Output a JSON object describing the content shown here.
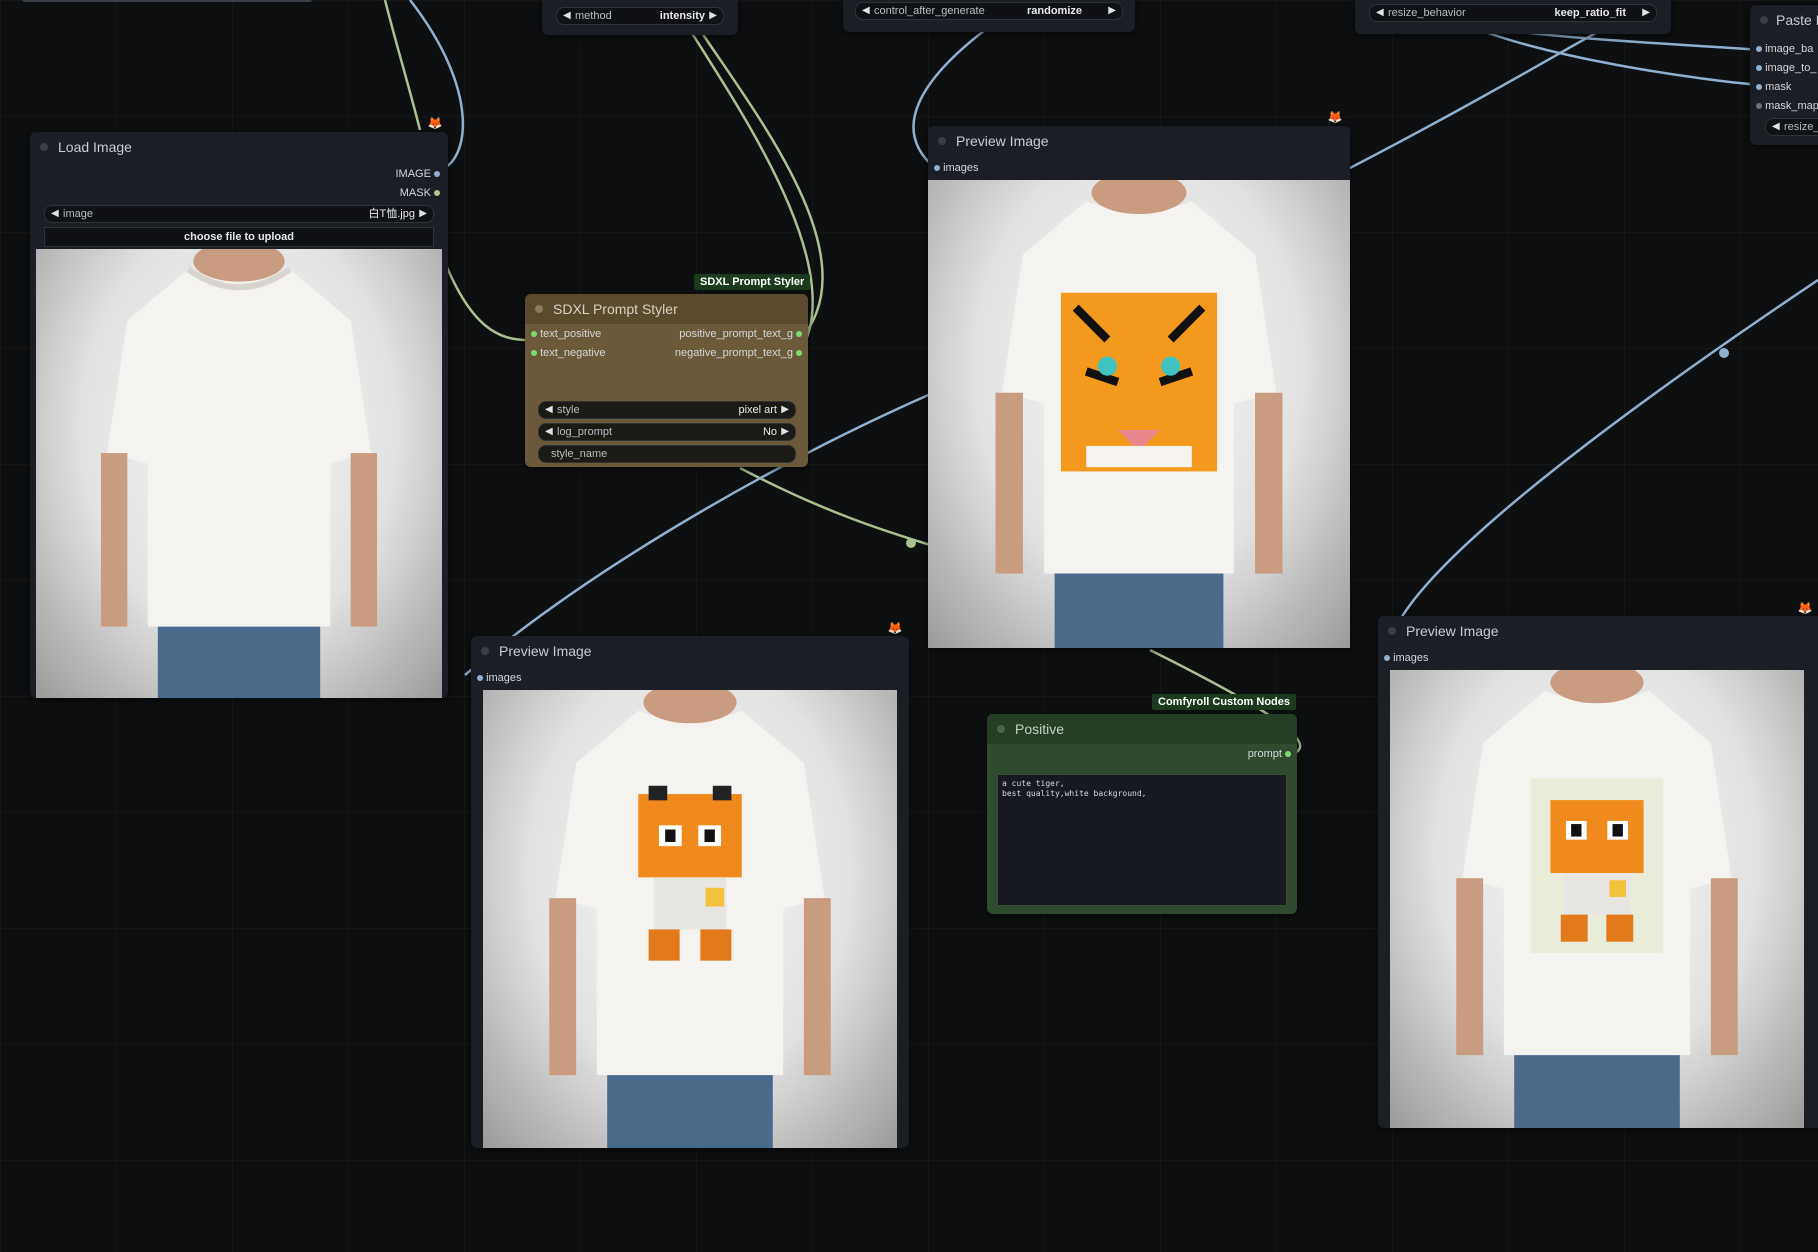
{
  "canvas": {
    "background": "#0e0f10"
  },
  "top_fragments": {
    "method": {
      "label": "method",
      "value": "intensity"
    },
    "control": {
      "label": "control_after_generate",
      "value": "randomize"
    },
    "resize": {
      "label": "resize_behavior",
      "value": "keep_ratio_fit"
    },
    "paste": {
      "title": "Paste B",
      "inputs": [
        "image_ba",
        "image_to_",
        "mask",
        "mask_map"
      ],
      "widget": "resize_"
    }
  },
  "load_image": {
    "title": "Load Image",
    "outputs": [
      "IMAGE",
      "MASK"
    ],
    "image_widget": {
      "label": "image",
      "value": "白T恤.jpg"
    },
    "upload_button": "choose file to upload"
  },
  "styler": {
    "group_tag": "SDXL Prompt Styler",
    "title": "SDXL Prompt Styler",
    "inputs": [
      "text_positive",
      "text_negative"
    ],
    "outputs": [
      "positive_prompt_text_g",
      "negative_prompt_text_g"
    ],
    "style": {
      "label": "style",
      "value": "pixel art"
    },
    "log_prompt": {
      "label": "log_prompt",
      "value": "No"
    },
    "style_name": "style_name",
    "color": "#6b5a3a"
  },
  "preview_top": {
    "title": "Preview Image",
    "input": "images"
  },
  "preview_bottom": {
    "title": "Preview Image",
    "input": "images"
  },
  "preview_right": {
    "title": "Preview Image",
    "input": "images"
  },
  "positive": {
    "group_tag": "Comfyroll Custom Nodes",
    "title": "Positive",
    "output": "prompt",
    "text_line1": "a cute tiger,",
    "text_line2": "best quality,white background,",
    "color": "#2f4a2f"
  },
  "icons": {
    "node_badge": "fox-icon",
    "tiger_face": "tiger-face-print",
    "pixel_tiger": "pixel-tiger-print"
  }
}
